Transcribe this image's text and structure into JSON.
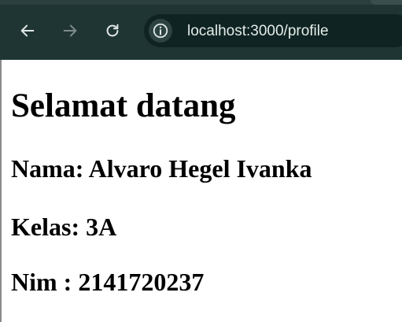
{
  "browser": {
    "url": "localhost:3000/profile",
    "icons": {
      "back": "arrow-left-icon",
      "forward": "arrow-right-icon",
      "reload": "reload-icon",
      "site_info": "info-icon"
    },
    "colors": {
      "toolbar": "#1f3533",
      "omnibox": "#0f2422",
      "icon": "#dfe7e4",
      "icon_disabled": "#7d8c89"
    }
  },
  "page": {
    "heading": "Selamat datang",
    "name_line": "Nama: Alvaro Hegel Ivanka",
    "class_line": "Kelas: 3A",
    "nim_line": "Nim : 2141720237"
  }
}
